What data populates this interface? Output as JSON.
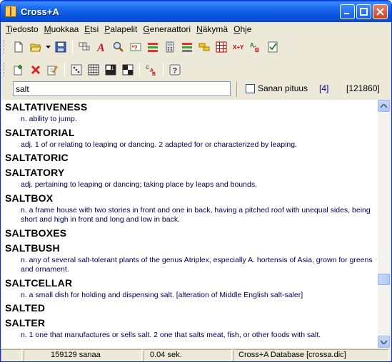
{
  "window": {
    "title": "Cross+A"
  },
  "menu": [
    {
      "label": "Tiedosto",
      "hot": "T"
    },
    {
      "label": "Muokkaa",
      "hot": "M"
    },
    {
      "label": "Etsi",
      "hot": "E"
    },
    {
      "label": "Palapelit",
      "hot": "P"
    },
    {
      "label": "Generaattori",
      "hot": "G"
    },
    {
      "label": "Näkymä",
      "hot": "N"
    },
    {
      "label": "Ohje",
      "hot": "O"
    }
  ],
  "toolbar1": [
    "new-file-icon",
    "open-folder-icon",
    "dropdown-arrow-icon",
    "save-icon",
    "anagram-grid-icon",
    "font-a-icon",
    "search-magnifier-icon",
    "wildcard-icon",
    "red-list-icon",
    "calculator-icon",
    "arrows-icon",
    "yellow-blocks-icon",
    "grid-pattern-icon",
    "xy-icon",
    "ab-icon",
    "checklist-icon"
  ],
  "toolbar1_text": {
    "xy": "X+Y"
  },
  "toolbar2": [
    "add-icon",
    "delete-icon",
    "edit-icon",
    "dice-icon",
    "grid-icon",
    "number-grid-icon",
    "checker-icon",
    "cab-icon",
    "help-icon"
  ],
  "search": {
    "value": "salt",
    "checkbox_label": "Sanan pituus",
    "length": "[4]",
    "total": "[121860]"
  },
  "entries": [
    {
      "word": "SALTATIVENESS",
      "def": "n. ability to jump."
    },
    {
      "word": "SALTATORIAL",
      "def": "adj. 1 of or relating to leaping or dancing. 2 adapted for or characterized by leaping."
    },
    {
      "word": "SALTATORIC",
      "def": ""
    },
    {
      "word": "SALTATORY",
      "def": "adj. pertaining to leaping or dancing; taking place by leaps and bounds."
    },
    {
      "word": "SALTBOX",
      "def": "n. a frame house with two stories in front and one in back, having a pitched roof with unequal sides, being short and high in front and long and low in back."
    },
    {
      "word": "SALTBOXES",
      "def": ""
    },
    {
      "word": "SALTBUSH",
      "def": "n. any of several salt-tolerant plants of the genus Atriplex, especially A. hortensis of Asia, grown for greens and ornament."
    },
    {
      "word": "SALTCELLAR",
      "def": "n. a small dish for holding and dispensing salt. [alteration of Middle English salt-saler]"
    },
    {
      "word": "SALTED",
      "def": ""
    },
    {
      "word": "SALTER",
      "def": "n. 1 one that manufactures or sells salt. 2 one that salts meat, fish, or other foods with salt."
    }
  ],
  "status": {
    "count": "159129 sanaa",
    "time": "0.04 sek.",
    "db": "Cross+A Database [crossa.dic]"
  }
}
